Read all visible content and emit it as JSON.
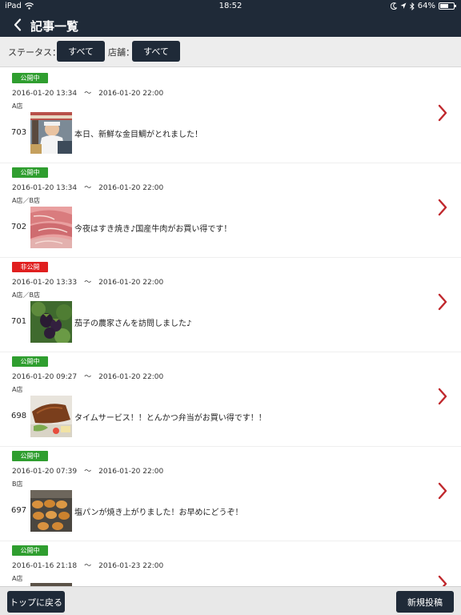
{
  "status_bar": {
    "device": "iPad",
    "time": "18:52",
    "battery": "64%",
    "battery_level": 0.64
  },
  "nav": {
    "title": "記事一覧"
  },
  "filters": {
    "status_label": "ステータス：",
    "status_value": "すべて",
    "store_label": "店舗：",
    "store_value": "すべて"
  },
  "articles": [
    {
      "status": "公開中",
      "status_type": "public",
      "period": "2016-01-20 13:34　〜　2016-01-20 22:00",
      "stores": "A店",
      "id": "703",
      "title": "本日、新鮮な金目鯛がとれました！",
      "thumb": "fisherman-photo"
    },
    {
      "status": "公開中",
      "status_type": "public",
      "period": "2016-01-20 13:34　〜　2016-01-20 22:00",
      "stores": "A店／B店",
      "id": "702",
      "title": "今夜はすき焼き♪国産牛肉がお買い得です！",
      "thumb": "beef-photo"
    },
    {
      "status": "非公開",
      "status_type": "private",
      "period": "2016-01-20 13:33　〜　2016-01-20 22:00",
      "stores": "A店／B店",
      "id": "701",
      "title": "茄子の農家さんを訪問しました♪",
      "thumb": "eggplant-photo"
    },
    {
      "status": "公開中",
      "status_type": "public",
      "period": "2016-01-20 09:27　〜　2016-01-20 22:00",
      "stores": "A店",
      "id": "698",
      "title": "タイムサービス！！とんかつ弁当がお買い得です！！",
      "thumb": "tonkatsu-photo"
    },
    {
      "status": "公開中",
      "status_type": "public",
      "period": "2016-01-20 07:39　〜　2016-01-20 22:00",
      "stores": "B店",
      "id": "697",
      "title": "塩パンが焼き上がりました！お早めにどうぞ！",
      "thumb": "bread-photo"
    },
    {
      "status": "公開中",
      "status_type": "public",
      "period": "2016-01-16 21:18　〜　2016-01-23 22:00",
      "stores": "A店",
      "id": "",
      "title": "",
      "thumb": ""
    }
  ],
  "bottom": {
    "back_label": "トップに戻る",
    "new_post_label": "新規投稿"
  },
  "colors": {
    "nav_bg": "#1f2a38",
    "public_badge": "#2f9e2f",
    "private_badge": "#e01f1f",
    "chevron": "#c0282d"
  }
}
